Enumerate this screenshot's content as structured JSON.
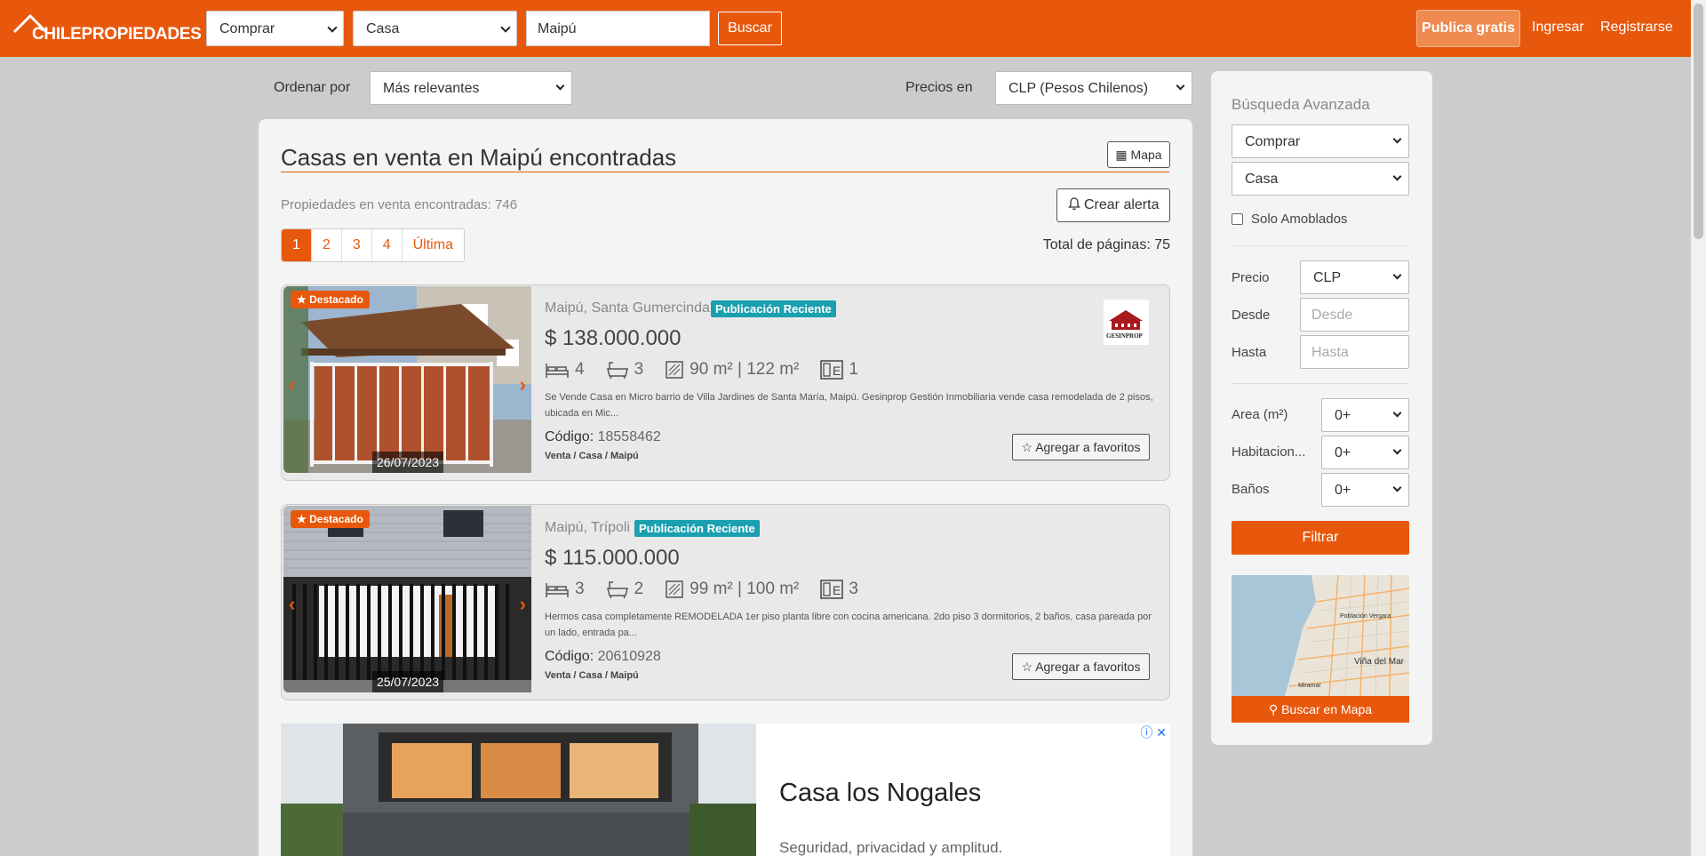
{
  "header": {
    "logo_text_bold": "CHILEPROPIEDADES",
    "operation_select": "Comprar",
    "type_select": "Casa",
    "location_input": "Maipú",
    "search_button": "Buscar",
    "publish_button": "Publica gratis",
    "login_link": "Ingresar",
    "register_link": "Registrarse"
  },
  "sort": {
    "order_label": "Ordenar por",
    "order_value": "Más relevantes",
    "price_label": "Precios en",
    "price_value": "CLP (Pesos Chilenos)"
  },
  "results": {
    "title": "Casas en venta en Maipú encontradas",
    "map_button": "Mapa",
    "found_text": "Propiedades en venta encontradas: 746",
    "alert_button": "Crear alerta",
    "pages": [
      "1",
      "2",
      "3",
      "4",
      "Última"
    ],
    "total_pages": "Total de páginas: 75"
  },
  "listings": [
    {
      "badge": "Destacado",
      "location": "Maipú, Santa Gumercinda",
      "new_badge": "Publicación Reciente",
      "price": "$ 138.000.000",
      "bedrooms": "4",
      "bathrooms": "3",
      "area": "90 m² | 122 m²",
      "parking": "1",
      "description": "Se Vende Casa en Micro barrio de Villa Jardines de Santa María, Maipú. Gesinprop Gestión Inmobiliaria vende casa remodelada de 2 pisos, ubicada en Mic...",
      "code_label": "Código:",
      "code": "18558462",
      "path": "Venta / Casa / Maipú",
      "date": "26/07/2023",
      "favorite_button": "Agregar a favoritos",
      "agency": "GESINPROP"
    },
    {
      "badge": "Destacado",
      "location": "Maipú, Trípoli",
      "new_badge": "Publicación Reciente",
      "price": "$ 115.000.000",
      "bedrooms": "3",
      "bathrooms": "2",
      "area": "99 m² | 100 m²",
      "parking": "3",
      "description": "Hermos casa completamente REMODELADA 1er piso planta libre con cocina americana. 2do piso 3 dormitorios, 2 baños, casa pareada por un lado, entrada pa...",
      "code_label": "Código:",
      "code": "20610928",
      "path": "Venta / Casa / Maipú",
      "date": "25/07/2023",
      "favorite_button": "Agregar a favoritos"
    }
  ],
  "ad": {
    "title": "Casa los Nogales",
    "subtitle": "Seguridad, privacidad y amplitud.",
    "info_icon": "ⓘ",
    "close_icon": "✕"
  },
  "sidebar": {
    "heading": "Búsqueda Avanzada",
    "operation": "Comprar",
    "type": "Casa",
    "furnished_label": "Solo Amoblados",
    "price_label": "Precio",
    "currency": "CLP",
    "from_label": "Desde",
    "from_placeholder": "Desde",
    "to_label": "Hasta",
    "to_placeholder": "Hasta",
    "area_label": "Area (m²)",
    "area_value": "0+",
    "rooms_label": "Habitacion...",
    "rooms_value": "0+",
    "baths_label": "Baños",
    "baths_value": "0+",
    "filter_button": "Filtrar",
    "map_button": "Buscar en Mapa",
    "map_labels": [
      "Población Vergara",
      "Viña del Mar",
      "Miramar"
    ]
  },
  "colors": {
    "brand": "#e8580c",
    "new_badge": "#1aa0b0"
  }
}
